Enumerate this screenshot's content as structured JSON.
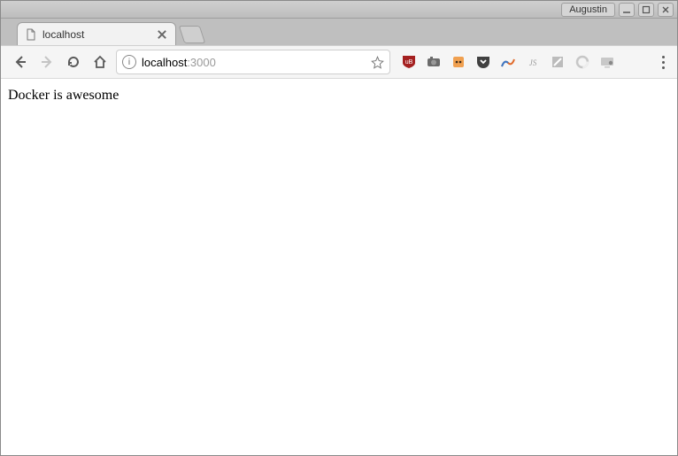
{
  "window": {
    "user_label": "Augustin"
  },
  "tabs": {
    "active": {
      "title": "localhost"
    }
  },
  "omnibox": {
    "host": "localhost",
    "port": ":3000"
  },
  "extensions": {
    "ublock": "uBlock",
    "camera": "Screenshot",
    "tampermonkey": "Tampermonkey",
    "pocket": "Pocket",
    "lighthouse": "Lighthouse",
    "js": "JS",
    "fill": "Form Fill",
    "adguard": "AdGuard",
    "devtools": "DevTools"
  },
  "page": {
    "body_text": "Docker is awesome"
  }
}
